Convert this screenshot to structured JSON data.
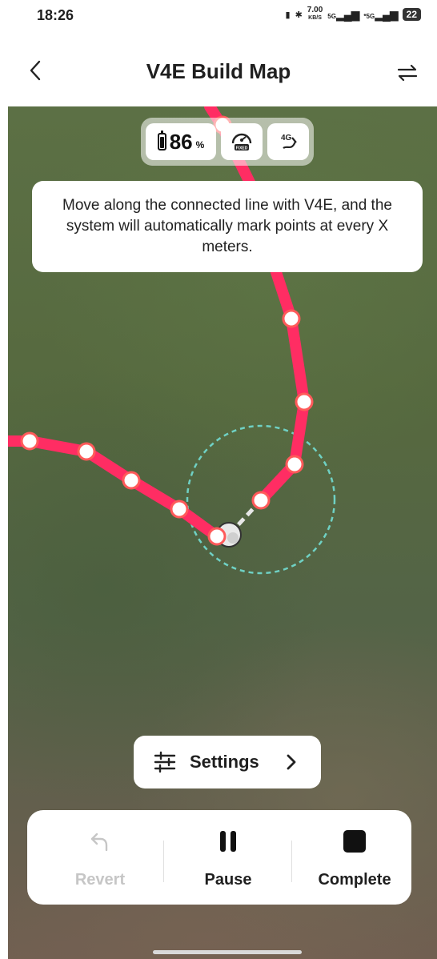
{
  "status_bar": {
    "time": "18:26",
    "net_speed_value": "7.00",
    "net_speed_unit": "KB/S",
    "network_1": "5G",
    "network_2": "*5G",
    "battery": "22"
  },
  "header": {
    "title": "V4E Build Map",
    "back_icon": "chevron-left-icon",
    "switch_icon": "swap-arrows-icon"
  },
  "device_status": {
    "battery_value": "86",
    "battery_unit": "%",
    "rtk_label": "FIXED",
    "signal_label": "4G"
  },
  "tooltip": {
    "text": "Move along the connected line with V4E, and the system will automatically mark points at every X meters."
  },
  "settings_button": {
    "label": "Settings",
    "icon": "sliders-icon"
  },
  "controls": {
    "revert": {
      "label": "Revert",
      "icon": "undo-arrow-icon",
      "enabled": false
    },
    "pause": {
      "label": "Pause",
      "icon": "pause-icon",
      "enabled": true
    },
    "complete": {
      "label": "Complete",
      "icon": "stop-square-icon",
      "enabled": true
    }
  },
  "colors": {
    "route": "#ff2d63",
    "range_circle": "#6fd1c4",
    "panel_bg": "#ffffff"
  }
}
